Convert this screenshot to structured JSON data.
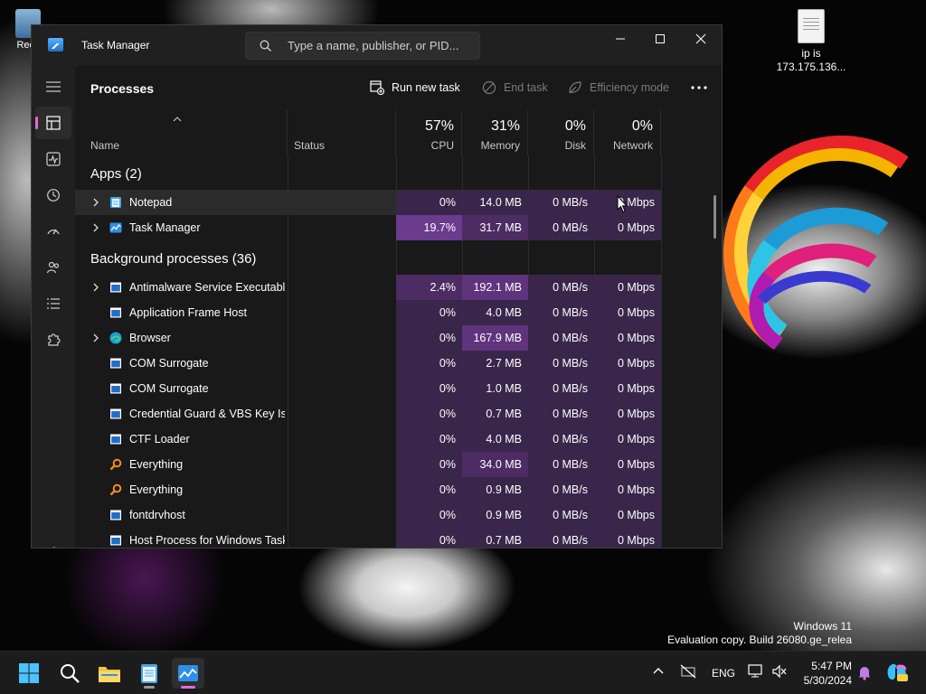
{
  "desktop": {
    "file_icon_label_1": "ip is",
    "file_icon_label_2": "173.175.136...",
    "recycle_label": "Recy",
    "watermark_line1": "Windows 11",
    "watermark_line2": "Evaluation copy. Build 26080.ge_relea"
  },
  "window": {
    "title": "Task Manager",
    "search_placeholder": "Type a name, publisher, or PID..."
  },
  "toolbar": {
    "page_title": "Processes",
    "run_new_task": "Run new task",
    "end_task": "End task",
    "efficiency_mode": "Efficiency mode"
  },
  "columns": {
    "name": "Name",
    "status": "Status",
    "cpu_pct": "57%",
    "cpu": "CPU",
    "memory_pct": "31%",
    "memory": "Memory",
    "disk_pct": "0%",
    "disk": "Disk",
    "network_pct": "0%",
    "network": "Network"
  },
  "groups": {
    "apps": "Apps (2)",
    "background": "Background processes (36)"
  },
  "apps": [
    {
      "name": "Notepad",
      "cpu": "0%",
      "memory": "14.0 MB",
      "disk": "0 MB/s",
      "network": "0 Mbps",
      "icon": "notepad-icon",
      "expandable": true
    },
    {
      "name": "Task Manager",
      "cpu": "19.7%",
      "memory": "31.7 MB",
      "disk": "0 MB/s",
      "network": "0 Mbps",
      "icon": "task-manager-icon",
      "expandable": true
    }
  ],
  "background": [
    {
      "name": "Antimalware Service Executable",
      "cpu": "2.4%",
      "memory": "192.1 MB",
      "disk": "0 MB/s",
      "network": "0 Mbps",
      "icon": "app-window-icon",
      "expandable": true
    },
    {
      "name": "Application Frame Host",
      "cpu": "0%",
      "memory": "4.0 MB",
      "disk": "0 MB/s",
      "network": "0 Mbps",
      "icon": "app-window-icon",
      "expandable": false
    },
    {
      "name": "Browser",
      "cpu": "0%",
      "memory": "167.9 MB",
      "disk": "0 MB/s",
      "network": "0 Mbps",
      "icon": "edge-icon",
      "expandable": true
    },
    {
      "name": "COM Surrogate",
      "cpu": "0%",
      "memory": "2.7 MB",
      "disk": "0 MB/s",
      "network": "0 Mbps",
      "icon": "app-window-icon",
      "expandable": false
    },
    {
      "name": "COM Surrogate",
      "cpu": "0%",
      "memory": "1.0 MB",
      "disk": "0 MB/s",
      "network": "0 Mbps",
      "icon": "app-window-icon",
      "expandable": false
    },
    {
      "name": "Credential Guard & VBS Key Is...",
      "cpu": "0%",
      "memory": "0.7 MB",
      "disk": "0 MB/s",
      "network": "0 Mbps",
      "icon": "app-window-icon",
      "expandable": false
    },
    {
      "name": "CTF Loader",
      "cpu": "0%",
      "memory": "4.0 MB",
      "disk": "0 MB/s",
      "network": "0 Mbps",
      "icon": "app-window-icon",
      "expandable": false
    },
    {
      "name": "Everything",
      "cpu": "0%",
      "memory": "34.0 MB",
      "disk": "0 MB/s",
      "network": "0 Mbps",
      "icon": "everything-search-icon",
      "expandable": false
    },
    {
      "name": "Everything",
      "cpu": "0%",
      "memory": "0.9 MB",
      "disk": "0 MB/s",
      "network": "0 Mbps",
      "icon": "everything-search-icon",
      "expandable": false
    },
    {
      "name": "fontdrvhost",
      "cpu": "0%",
      "memory": "0.9 MB",
      "disk": "0 MB/s",
      "network": "0 Mbps",
      "icon": "app-window-icon",
      "expandable": false
    },
    {
      "name": "Host Process for Windows Tasks",
      "cpu": "0%",
      "memory": "0.7 MB",
      "disk": "0 MB/s",
      "network": "0 Mbps",
      "icon": "app-window-icon",
      "expandable": false
    }
  ],
  "taskbar": {
    "language": "ENG",
    "time": "5:47 PM",
    "date": "5/30/2024"
  },
  "colors": {
    "accent": "#e36ad8",
    "heat_low": "#39264a",
    "heat_mid": "#4c2c62",
    "heat_high": "#5f347d",
    "heat_max": "#6b3b8d"
  }
}
